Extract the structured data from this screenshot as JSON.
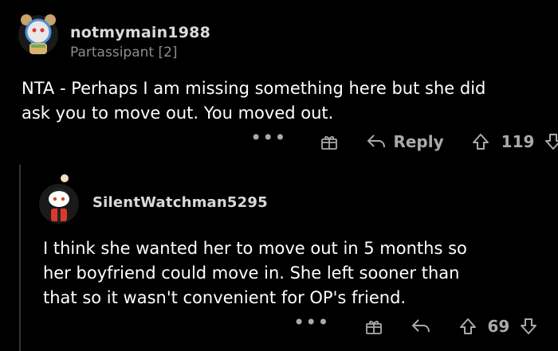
{
  "comments": [
    {
      "username": "notmymain1988",
      "flair": "Partassipant [2]",
      "body_lines": [
        "NTA - Perhaps I am missing something here but she did",
        "ask you to move out. You moved out."
      ],
      "more_label": "•••",
      "reply_label": "Reply",
      "score": "119",
      "icons": [
        "more-icon",
        "gift-icon",
        "reply-icon",
        "upvote-icon",
        "downvote-icon"
      ]
    },
    {
      "username": "SilentWatchman5295",
      "body_lines": [
        "I think she wanted her to move out in 5 months so",
        "her boyfriend could move in. She left sooner than",
        "that so it wasn't convenient for OP's friend."
      ],
      "more_label": "•••",
      "score": "69",
      "icons": [
        "more-icon",
        "gift-icon",
        "reply-icon",
        "upvote-icon",
        "downvote-icon"
      ]
    }
  ],
  "colors": {
    "background": "#000000",
    "text": "#ffffff",
    "meta": "#8b8d8f",
    "action": "#a8aaab",
    "thread_line": "#343536"
  }
}
